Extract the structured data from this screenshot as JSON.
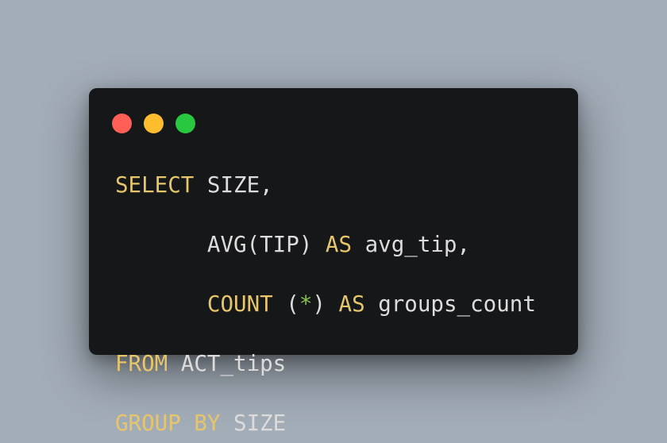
{
  "colors": {
    "background": "#a3adb8",
    "window": "#151718",
    "close": "#ff5f57",
    "minimize": "#febc2e",
    "zoom": "#28c840",
    "keyword": "#e7c66b",
    "identifier": "#dcdcdc",
    "operator": "#86c54a"
  },
  "window_controls": [
    {
      "name": "close",
      "color": "#ff5f57"
    },
    {
      "name": "minimize",
      "color": "#febc2e"
    },
    {
      "name": "zoom",
      "color": "#28c840"
    }
  ],
  "code": {
    "lines": [
      {
        "tokens": [
          {
            "type": "keyword",
            "text": "SELECT"
          },
          {
            "type": "identifier",
            "text": " SIZE,"
          }
        ]
      },
      {
        "tokens": [
          {
            "type": "identifier",
            "text": "       AVG(TIP) "
          },
          {
            "type": "keyword",
            "text": "AS"
          },
          {
            "type": "identifier",
            "text": " avg_tip,"
          }
        ]
      },
      {
        "tokens": [
          {
            "type": "identifier",
            "text": "       "
          },
          {
            "type": "keyword",
            "text": "COUNT"
          },
          {
            "type": "identifier",
            "text": " ("
          },
          {
            "type": "operator",
            "text": "*"
          },
          {
            "type": "identifier",
            "text": ") "
          },
          {
            "type": "keyword",
            "text": "AS"
          },
          {
            "type": "identifier",
            "text": " groups_count"
          }
        ]
      },
      {
        "tokens": [
          {
            "type": "keyword",
            "text": "FROM"
          },
          {
            "type": "identifier",
            "text": " ACT_tips"
          }
        ]
      },
      {
        "tokens": [
          {
            "type": "keyword",
            "text": "GROUP BY"
          },
          {
            "type": "identifier",
            "text": " SIZE"
          }
        ]
      }
    ]
  }
}
